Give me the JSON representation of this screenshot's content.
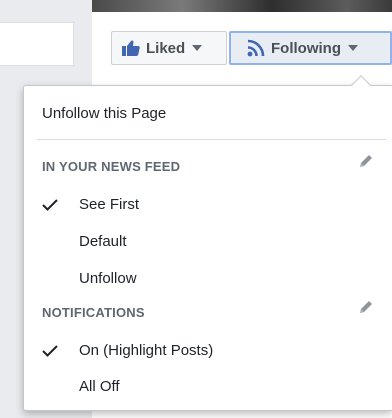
{
  "toolbar": {
    "liked_label": "Liked",
    "following_label": "Following"
  },
  "menu": {
    "unfollow_page": "Unfollow this Page",
    "news_feed": {
      "header": "IN YOUR NEWS FEED",
      "items": [
        {
          "label": "See First",
          "checked": true
        },
        {
          "label": "Default",
          "checked": false
        },
        {
          "label": "Unfollow",
          "checked": false
        }
      ]
    },
    "notifications": {
      "header": "NOTIFICATIONS",
      "items": [
        {
          "label": "On (Highlight Posts)",
          "checked": true
        },
        {
          "label": "All Off",
          "checked": false
        }
      ]
    }
  },
  "icons": {
    "liked": "thumbs-up-icon",
    "following": "rss-feed-icon",
    "edit": "pencil-icon",
    "check": "checkmark-icon"
  },
  "colors": {
    "brand_blue": "#4267b2",
    "following_border": "#8fb3ea",
    "header_gray": "#606770",
    "text": "#1d2129"
  }
}
